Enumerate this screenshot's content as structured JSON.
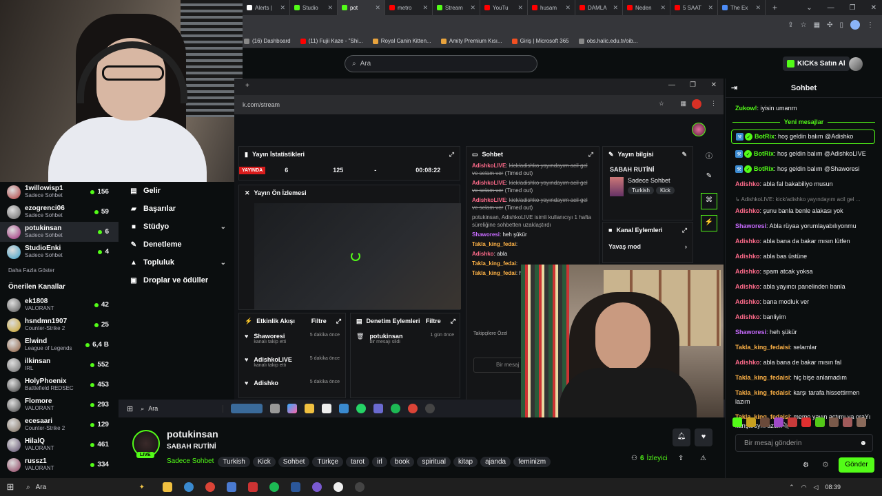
{
  "browser": {
    "tabs": [
      {
        "label": "Alerts |",
        "color": "#ffffff"
      },
      {
        "label": "Studio",
        "color": "#53fc18"
      },
      {
        "label": "pot",
        "color": "#53fc18",
        "active": true
      },
      {
        "label": "metro",
        "color": "#ff0000"
      },
      {
        "label": "Stream",
        "color": "#53fc18"
      },
      {
        "label": "YouTu",
        "color": "#ff0000"
      },
      {
        "label": "husam",
        "color": "#ff0000"
      },
      {
        "label": "DAMLA",
        "color": "#ff0000"
      },
      {
        "label": "Neden",
        "color": "#ff0000"
      },
      {
        "label": "5 SAAT",
        "color": "#ff0000"
      },
      {
        "label": "The Ex",
        "color": "#4c8bf5"
      }
    ],
    "new_tab": "+",
    "bookmarks": [
      {
        "label": "(16) Dashboard",
        "color": "#888"
      },
      {
        "label": "(11) Fujii Kaze - \"Shi...",
        "color": "#ff0000"
      },
      {
        "label": "Royal Canin Kitten...",
        "color": "#e8a33d"
      },
      {
        "label": "Amity Premium Kısı...",
        "color": "#e8a33d"
      },
      {
        "label": "Giriş | Microsoft 365",
        "color": "#f25022"
      },
      {
        "label": "obs.halic.edu.tr/oib...",
        "color": "#888"
      }
    ]
  },
  "header": {
    "search_placeholder": "Ara",
    "buy_kicks": "KICKs Satın Al"
  },
  "sidebar": {
    "following": [
      {
        "name": "1willowisp1",
        "category": "Sadece Sohbet",
        "viewers": "156",
        "color": "#b03a3a"
      },
      {
        "name": "ezogrenci06",
        "category": "Sadece Sohbet",
        "viewers": "59",
        "color": "#666"
      },
      {
        "name": "potukinsan",
        "category": "Sadece Sohbet",
        "viewers": "6",
        "color": "#a0297a",
        "selected": true
      },
      {
        "name": "StudioEnki",
        "category": "Sadece Sohbet",
        "viewers": "4",
        "color": "#3aa0c8"
      }
    ],
    "show_more": "Daha Fazla Göster",
    "recommended_title": "Önerilen Kanallar",
    "recommended": [
      {
        "name": "ek1808",
        "category": "VALORANT",
        "viewers": "42",
        "color": "#555"
      },
      {
        "name": "hsndmn1907",
        "category": "Counter-Strike 2",
        "viewers": "25",
        "color": "#c8a020"
      },
      {
        "name": "Elwind",
        "category": "League of Legends",
        "viewers": "6,4 B",
        "color": "#8a5a3a"
      },
      {
        "name": "ilkinsan",
        "category": "IRL",
        "viewers": "552",
        "color": "#6a6a6a"
      },
      {
        "name": "HolyPhoenix",
        "category": "Battlefield REDSEC",
        "viewers": "453",
        "color": "#3a3a3a"
      },
      {
        "name": "Flomore",
        "category": "VALORANT",
        "viewers": "293",
        "color": "#444"
      },
      {
        "name": "ecesaari",
        "category": "Counter-Strike 2",
        "viewers": "129",
        "color": "#7a6a5a"
      },
      {
        "name": "HilalQ",
        "category": "VALORANT",
        "viewers": "461",
        "color": "#5a4a6a"
      },
      {
        "name": "russz1",
        "category": "VALORANT",
        "viewers": "334",
        "color": "#8a3a5a"
      }
    ]
  },
  "creator_menu": [
    {
      "label": "Gelir",
      "icon": "revenue-icon",
      "glyph": "▤"
    },
    {
      "label": "Başarılar",
      "icon": "achievements-icon",
      "glyph": "▰"
    },
    {
      "label": "Stüdyo",
      "icon": "studio-icon",
      "glyph": "■",
      "expand": true
    },
    {
      "label": "Denetleme",
      "icon": "moderation-icon",
      "glyph": "✎"
    },
    {
      "label": "Topluluk",
      "icon": "community-icon",
      "glyph": "▲",
      "expand": true
    },
    {
      "label": "Droplar ve ödüller",
      "icon": "drops-icon",
      "glyph": "▣"
    }
  ],
  "dashboard": {
    "url": "k.com/stream",
    "stats_title": "Yayın İstatistikleri",
    "live_label": "YAYINDA",
    "stats": [
      "6",
      "125",
      "-",
      "00:08:22"
    ],
    "preview_title": "Yayın Ön İzlemesi",
    "chat_title": "Sohbet",
    "chat": [
      {
        "user": "AdishkoLIVE",
        "text": "kick/adishko yayındayım acil gel ve selam ver",
        "note": "(Timed out)",
        "strike": true
      },
      {
        "user": "AdishkoLIVE",
        "text": "kick/adishko yayındayım acil gel ve selam ver",
        "note": "(Timed out)",
        "strike": true
      },
      {
        "user": "AdishkoLIVE",
        "text": "kick/adishko yayındayım acil gel ve selam ver",
        "note": "(Timed out)",
        "strike": true
      },
      {
        "user": "",
        "text": "potukinsan, AdishkoLIVE isimli kullanıcıyı 1 hafta süreliğine sohbetten uzaklaştırdı",
        "note": "",
        "strike": false
      },
      {
        "user": "Shaworesi",
        "text": "heh şükür",
        "note": "",
        "strike": false
      },
      {
        "user": "Takla_king_fedai",
        "text": "",
        "note": "",
        "strike": false
      },
      {
        "user": "Adishko",
        "text": "abla",
        "note": "",
        "strike": false
      },
      {
        "user": "Takla_king_fedai",
        "text": "",
        "note": "",
        "strike": false
      },
      {
        "user": "Takla_king_fedai",
        "text": "hissettirmen lazım",
        "note": "",
        "strike": false
      }
    ],
    "chat_footer": "Takipçilere Özel",
    "chat_input": "Bir mesaj",
    "info_title": "Yayın bilgisi",
    "info_stream_title": "SABAH RUTİNİ",
    "info_category": "Sadece Sohbet",
    "info_tags": [
      "Turkish",
      "Kick"
    ],
    "actions_title": "Kanal Eylemleri",
    "slow_mode": "Yavaş mod",
    "activity_title": "Etkinlik Akışı",
    "filter_label": "Filtre",
    "activity": [
      {
        "user": "Shaworesi",
        "action": "kanalı takip etti",
        "time": "5 dakika önce"
      },
      {
        "user": "AdishkoLIVE",
        "action": "kanalı takip etti",
        "time": "5 dakika önce"
      },
      {
        "user": "Adishko",
        "action": "",
        "time": "5 dakika önce"
      }
    ],
    "mod_title": "Denetim Eylemleri",
    "mod_actions": [
      {
        "user": "potukinsan",
        "action": "bir mesajı sildi",
        "time": "1 gün önce"
      }
    ],
    "taskbar_search": "Ara"
  },
  "stream": {
    "channel": "potukinsan",
    "title": "SABAH RUTİNİ",
    "category": "Sadece Sohbet",
    "tags": [
      "Turkish",
      "Kick",
      "Sohbet",
      "Türkçe",
      "tarot",
      "irl",
      "book",
      "spiritual",
      "kitap",
      "ajanda",
      "feminizm"
    ],
    "viewers": "6",
    "viewers_label": "İzleyici",
    "live": "LIVE"
  },
  "chat": {
    "title": "Sohbet",
    "new_messages": "Yeni mesajlar",
    "messages": [
      {
        "user": "Zukow!",
        "text": "iyisin umarım",
        "color": "#53fc18"
      },
      {
        "user": "BotRix",
        "text": "hoş geldin balım @Adishko",
        "color": "#53fc18",
        "bot": true,
        "highlight": true
      },
      {
        "user": "BotRix",
        "text": "hoş geldin balım @AdishkoLIVE",
        "color": "#53fc18",
        "bot": true
      },
      {
        "user": "BotRix",
        "text": "hoş geldin balım @Shaworesi",
        "color": "#53fc18",
        "bot": true
      },
      {
        "user": "Adishko",
        "text": "abla fal bakabiliyo musun",
        "color": "#ff6b8b"
      },
      {
        "user": "",
        "text": "AdishkoLIVE: kick/adishko yayındayım acil gel ...",
        "color": "#888",
        "reply": true
      },
      {
        "user": "Adishko",
        "text": "şunu banla benle alakası yok",
        "color": "#ff6b8b"
      },
      {
        "user": "Shaworesi",
        "text": "Abla rüyaa yorumlayabılıyonmu",
        "color": "#c86bff"
      },
      {
        "user": "Adishko",
        "text": "abla bana da bakar mısın lütfen",
        "color": "#ff6b8b"
      },
      {
        "user": "Adishko",
        "text": "abla bas üstüne",
        "color": "#ff6b8b"
      },
      {
        "user": "Adishko",
        "text": "spam atcak yoksa",
        "color": "#ff6b8b"
      },
      {
        "user": "Adishko",
        "text": "abla yayıncı panelinden banla",
        "color": "#ff6b8b"
      },
      {
        "user": "Adishko",
        "text": "bana modluk ver",
        "color": "#ff6b8b"
      },
      {
        "user": "Adishko",
        "text": "banliyim",
        "color": "#ff6b8b"
      },
      {
        "user": "Shaworesi",
        "text": "heh şükür",
        "color": "#c86bff"
      },
      {
        "user": "Takla_king_fedaisi",
        "text": "selamlar",
        "color": "#ffb347"
      },
      {
        "user": "Adishko",
        "text": "abla bana de bakar mısın fal",
        "color": "#ff6b8b"
      },
      {
        "user": "Takla_king_fedaisi",
        "text": "hiç bişe anlamadım",
        "color": "#ffb347"
      },
      {
        "user": "Takla_king_fedaisi",
        "text": "karşı tarafa hissettirmen lazım",
        "color": "#ffb347"
      },
      {
        "user": "Takla_king_fedaisi",
        "text": "memo yayın açtımı ya oraYı karıştırsym azcık🔌",
        "color": "#ffb347"
      }
    ],
    "input_placeholder": "Bir mesaj gönderin",
    "send": "Gönder"
  },
  "taskbar": {
    "search": "Ara",
    "time": "08:39"
  }
}
